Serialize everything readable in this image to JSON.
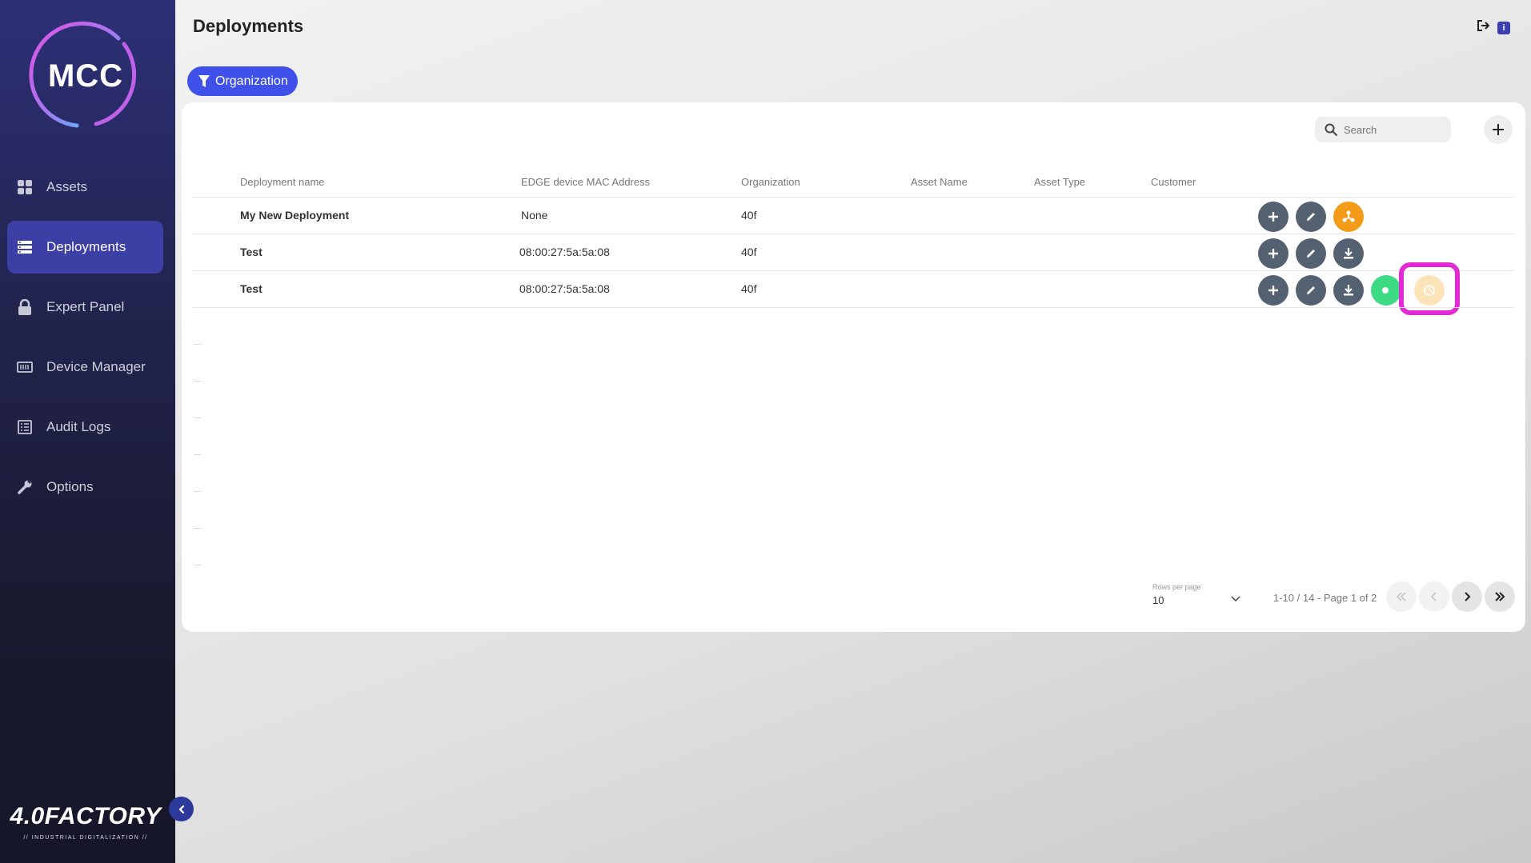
{
  "app": {
    "logo_text": "MCC",
    "brand_name": "4.0FACTORY",
    "brand_tagline": "// INDUSTRIAL DIGITALIZATION //"
  },
  "sidebar": {
    "items": [
      {
        "label": "Assets",
        "icon": "grid-icon"
      },
      {
        "label": "Deployments",
        "icon": "server-list-icon",
        "active": true
      },
      {
        "label": "Expert Panel",
        "icon": "lock-icon"
      },
      {
        "label": "Device Manager",
        "icon": "keyboard-icon"
      },
      {
        "label": "Audit Logs",
        "icon": "list-icon"
      },
      {
        "label": "Options",
        "icon": "wrench-icon"
      }
    ]
  },
  "header": {
    "title": "Deployments",
    "info_label": "i"
  },
  "filter": {
    "label": "Organization"
  },
  "search": {
    "placeholder": "Search"
  },
  "table": {
    "columns": [
      "Deployment name",
      "EDGE device MAC Address",
      "Organization",
      "Asset Name",
      "Asset Type",
      "Customer"
    ],
    "rows": [
      {
        "name": "My New Deployment",
        "mac": "None",
        "organization": "40f",
        "asset_name": "",
        "asset_type": "",
        "customer": "",
        "actions": [
          "add",
          "edit",
          "deploy"
        ]
      },
      {
        "name": "Test",
        "mac": "08:00:27:5a:5a:08",
        "organization": "40f",
        "asset_name": "",
        "asset_type": "",
        "customer": "",
        "actions": [
          "add",
          "edit",
          "download"
        ]
      },
      {
        "name": "Test",
        "mac": "08:00:27:5a:5a:08",
        "organization": "40f",
        "asset_name": "",
        "asset_type": "",
        "customer": "",
        "actions": [
          "add",
          "edit",
          "download",
          "status",
          "history"
        ]
      }
    ]
  },
  "pagination": {
    "rows_per_page_label": "Rows per page",
    "rows_per_page_value": "10",
    "page_info": "1-10 / 14 - Page 1 of 2"
  },
  "colors": {
    "accent": "#3f51e8",
    "sidebar_active": "#3c3fa3",
    "action_grey": "#546170",
    "action_orange": "#f59b1a",
    "action_green": "#3ddc84",
    "highlight": "#e22bd3"
  }
}
